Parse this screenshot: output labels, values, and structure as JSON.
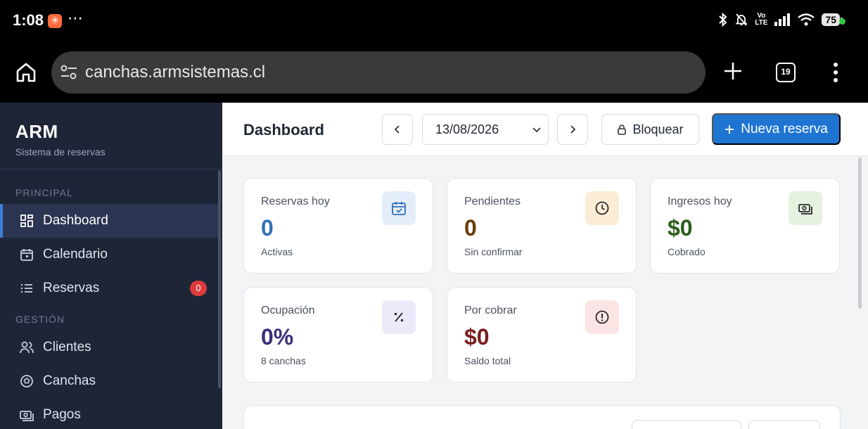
{
  "status": {
    "time": "1:08",
    "volte_top": "Vo",
    "volte_bottom": "LTE",
    "battery": "75"
  },
  "browser": {
    "url": "canchas.armsistemas.cl",
    "tab_count": "19"
  },
  "sidebar": {
    "brand": "ARM",
    "brand_sub": "Sistema de reservas",
    "sections": [
      {
        "label": "PRINCIPAL"
      },
      {
        "label": "GESTIÓN"
      }
    ],
    "items": [
      {
        "label": "Dashboard",
        "active": true
      },
      {
        "label": "Calendario"
      },
      {
        "label": "Reservas",
        "badge": "0"
      },
      {
        "label": "Clientes"
      },
      {
        "label": "Canchas"
      },
      {
        "label": "Pagos"
      }
    ]
  },
  "header": {
    "title": "Dashboard",
    "date": "13/08/2026",
    "lock_label": "Bloquear",
    "new_label": "Nueva reserva"
  },
  "cards": [
    {
      "label": "Reservas hoy",
      "value": "0",
      "sub": "Activas",
      "color": "#2f6fb8",
      "icon_bg": "#e4eefa",
      "icon": "calendar-check-icon"
    },
    {
      "label": "Pendientes",
      "value": "0",
      "sub": "Sin confirmar",
      "color": "#6a3c0c",
      "icon_bg": "#fbecd6",
      "icon": "clock-icon"
    },
    {
      "label": "Ingresos hoy",
      "value": "$0",
      "sub": "Cobrado",
      "color": "#2b5e1c",
      "icon_bg": "#e4f2df",
      "icon": "cash-icon"
    },
    {
      "label": "Ocupación",
      "value": "0%",
      "sub": "8 canchas",
      "color": "#3a2f7a",
      "icon_bg": "#ebeafb",
      "icon": "percent-icon"
    },
    {
      "label": "Por cobrar",
      "value": "$0",
      "sub": "Saldo total",
      "color": "#7a1f1f",
      "icon_bg": "#fbe4e4",
      "icon": "alert-circle-icon"
    }
  ]
}
